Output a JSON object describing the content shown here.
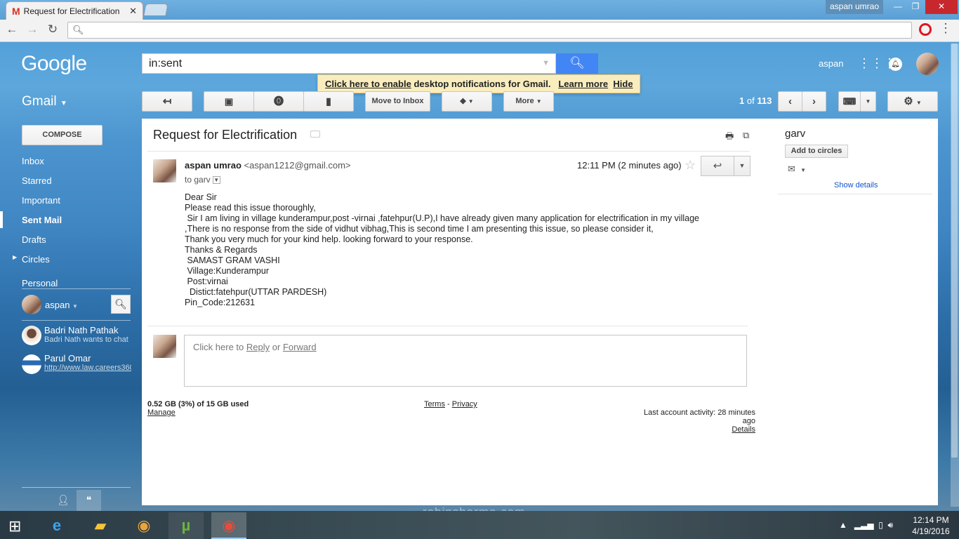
{
  "browser": {
    "tab_title": "Request for Electrification",
    "profile_name": "aspan umrao",
    "address": ""
  },
  "gmail": {
    "logo": "Google",
    "search_value": "in:sent",
    "user_name": "aspan",
    "notification": {
      "link": "Click here to enable",
      "text": "desktop notifications for Gmail.",
      "learn": "Learn more",
      "hide": "Hide"
    },
    "label": "Gmail",
    "toolbar": {
      "move_to_inbox": "Move to Inbox",
      "more": "More"
    },
    "pager": {
      "current": "1",
      "of": "of",
      "total": "113"
    }
  },
  "sidebar": {
    "compose": "COMPOSE",
    "items": [
      "Inbox",
      "Starred",
      "Important",
      "Sent Mail",
      "Drafts",
      "Circles"
    ],
    "personal": "Personal",
    "chat_user": "aspan",
    "contacts": [
      {
        "name": "Badri Nath Pathak",
        "status": "Badri Nath wants to chat"
      },
      {
        "name": "Parul Omar",
        "status": "http://www.law.careers360"
      }
    ]
  },
  "message": {
    "subject": "Request for Electrification",
    "sender_name": "aspan umrao",
    "sender_email": "<aspan1212@gmail.com>",
    "to": "to garv",
    "time": "12:11 PM (2 minutes ago)",
    "body": "Dear Sir\nPlease read this issue thoroughly,\n Sir I am living in village kunderampur,post -virnai ,fatehpur(U.P),I have already given many application for electrification in my village\n,There is no response from the side of vidhut vibhag,This is second time I am presenting this issue, so please consider it,\nThank you very much for your kind help. looking forward to your response.\nThanks & Regards\n SAMAST GRAM VASHI\n Village:Kunderampur\n Post:virnai\n  Distict:fatehpur(UTTAR PARDESH)\nPin_Code:212631",
    "reply_prompt": "Click here to",
    "reply": "Reply",
    "or": "or",
    "forward": "Forward"
  },
  "footer": {
    "storage": "0.52 GB (3%) of 15 GB used",
    "manage": "Manage",
    "terms": "Terms",
    "dash": "-",
    "privacy": "Privacy",
    "activity": "Last account activity: 28 minutes ago",
    "details": "Details"
  },
  "contact_pane": {
    "name": "garv",
    "add": "Add to circles",
    "show": "Show details"
  },
  "taskbar": {
    "time": "12:14 PM",
    "date": "4/19/2016"
  },
  "watermark": "robinsharma.com",
  "colors": {
    "accent": "#4285f4",
    "notif_bg": "#f9edbe",
    "close": "#c7282d"
  }
}
